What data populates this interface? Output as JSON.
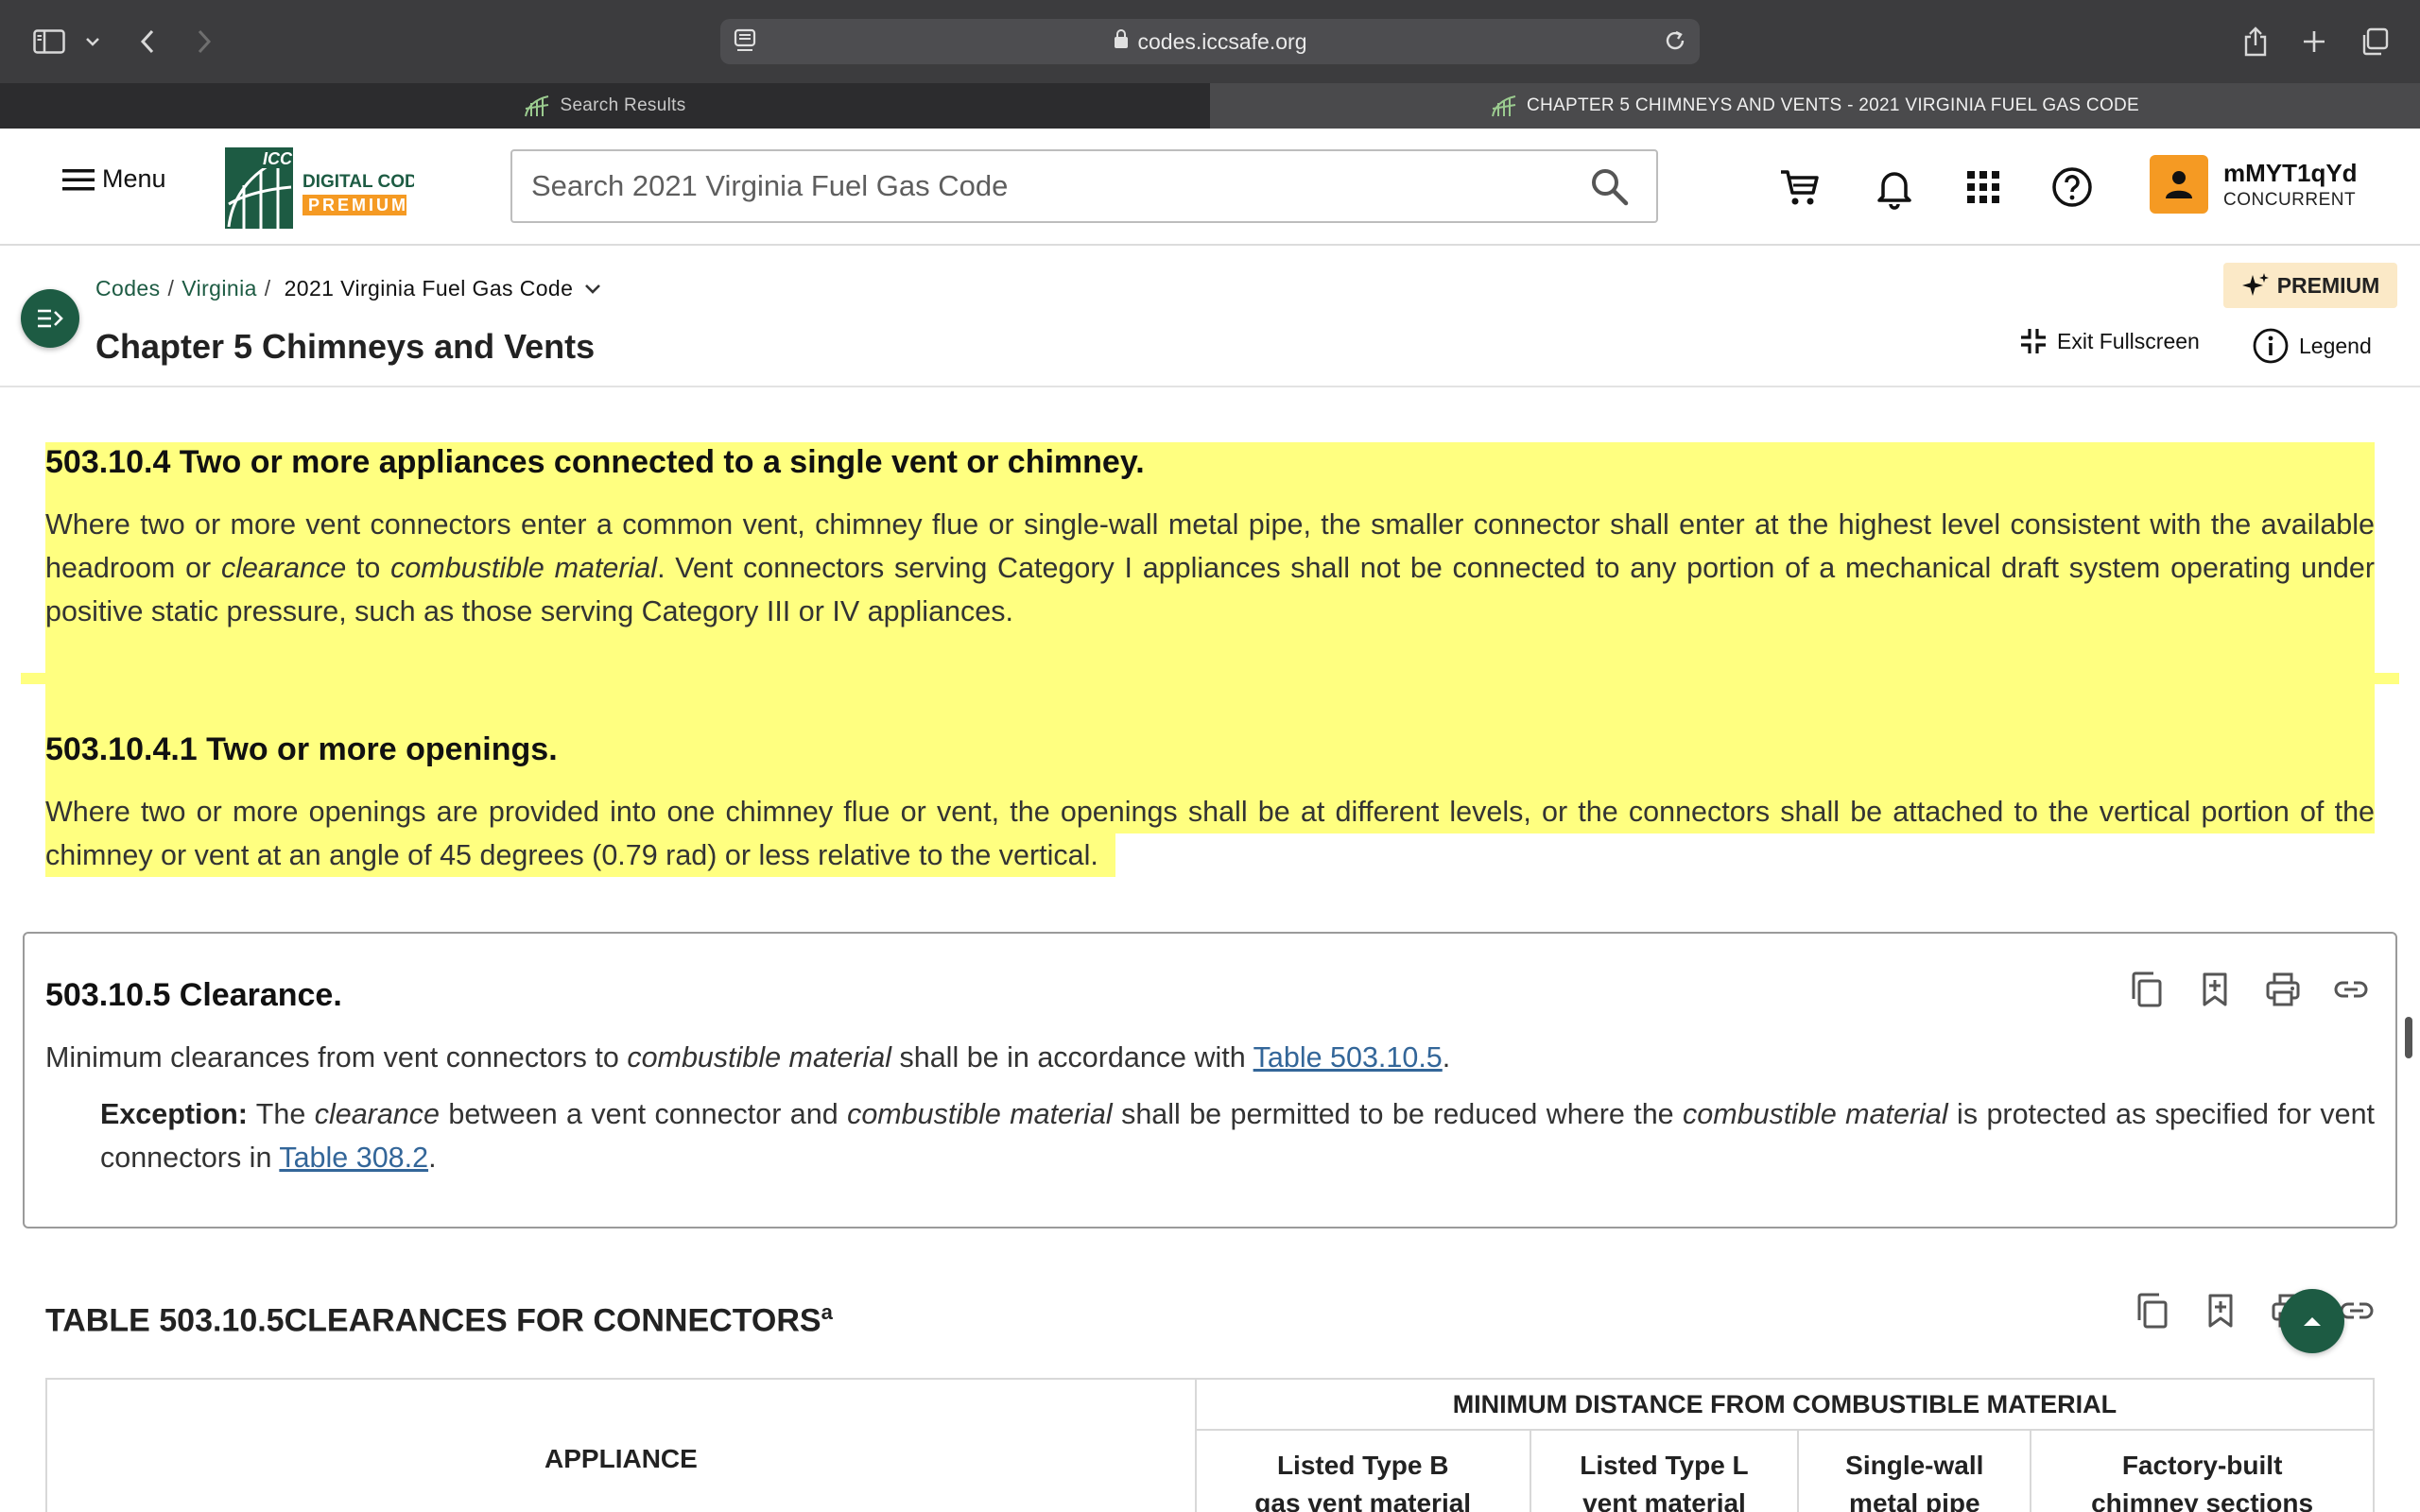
{
  "browser": {
    "url": "codes.iccsafe.org",
    "tabs": [
      {
        "label": "Search Results",
        "active": false
      },
      {
        "label": "CHAPTER 5 CHIMNEYS AND VENTS - 2021 VIRGINIA FUEL GAS CODE",
        "active": true
      }
    ]
  },
  "header": {
    "menu_label": "Menu",
    "search_placeholder": "Search 2021 Virginia Fuel Gas Code",
    "user": {
      "name": "mMYT1qYd",
      "status": "CONCURRENT"
    }
  },
  "subheader": {
    "breadcrumb": {
      "codes": "Codes",
      "state": "Virginia",
      "current": "2021 Virginia Fuel Gas Code"
    },
    "title": "Chapter 5 Chimneys and Vents",
    "premium_label": "PREMIUM",
    "exit_fullscreen_label": "Exit Fullscreen",
    "legend_label": "Legend"
  },
  "sections": {
    "s1": {
      "title": "503.10.4 Two or more appliances connected to a single vent or chimney.",
      "t1": "Where two or more vent connectors enter a common vent, chimney flue or single-wall metal pipe, the smaller connector shall enter at the highest level consistent with the available headroom or ",
      "e1": "clearance",
      "t2": " to ",
      "e2": "combustible material",
      "t3": ". Vent connectors serving Category I appliances shall not be connected to any portion of a mechanical draft system operating under positive static pressure, such as those serving Category III or IV appliances."
    },
    "s2": {
      "title": "503.10.4.1 Two or more openings.",
      "text": "Where two or more openings are provided into one chimney flue or vent, the openings shall be at different levels, or the connectors shall be attached to the vertical portion of the chimney or vent at an angle of 45 degrees (0.79 rad) or less relative to the vertical."
    },
    "s3": {
      "title": "503.10.5 Clearance.",
      "t1": "Minimum clearances from vent connectors to ",
      "e1": "combustible material",
      "t2": " shall be in accordance with ",
      "link": "Table 503.10.5",
      "t3": ".",
      "exception": {
        "label": "Exception:",
        "t1": " The ",
        "e1": "clearance",
        "t2": " between a vent connector and ",
        "e2": "combustible material",
        "t3": " shall be permitted to be reduced where the ",
        "e3": "combustible material",
        "t4": " is protected as specified for vent connectors in ",
        "link": "Table 308.2",
        "t5": "."
      }
    }
  },
  "table": {
    "title": "TABLE 503.10.5CLEARANCES FOR CONNECTORS",
    "title_sup": "a",
    "appliance_header": "APPLIANCE",
    "group_header": "MINIMUM DISTANCE FROM COMBUSTIBLE MATERIAL",
    "columns": [
      {
        "line1": "Listed Type B",
        "line2": "gas vent material"
      },
      {
        "line1": "Listed Type L",
        "line2": "vent material"
      },
      {
        "line1": "Single-wall",
        "line2": "metal pipe"
      },
      {
        "line1": "Factory-built",
        "line2": "chimney sections"
      }
    ]
  },
  "colors": {
    "brand_green": "#1d5b43",
    "highlight": "#ffff80",
    "accent_orange": "#f59a23",
    "link": "#336699"
  }
}
